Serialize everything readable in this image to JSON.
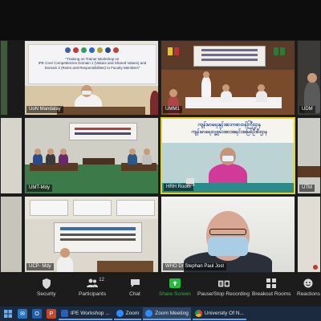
{
  "tiles": {
    "uon_mandalay": {
      "label": "UoN Mandalay",
      "banner_line1": "\"Training on Trainer Workshop on",
      "banner_line2": "IPE Core Competencies Domain 1 (Values and Shared Values) and",
      "banner_line3": "Domain 2 (Roles and Responsibilities) to Faculty Members\""
    },
    "umm1": {
      "label": "UMM1"
    },
    "udm": {
      "label": "UDM"
    },
    "umt_mdy": {
      "label": "UMT-Mdy"
    },
    "hrh_room": {
      "label": "HRH Room",
      "banner_line1": "ကျန်းမာရေးနှင့်အားကစားဝန်ကြီးဌာန",
      "banner_line2": "ကျန်းမာရေးလူ့စွမ်းအားအရင်းအမြစ်ဦးစီးဌာန"
    },
    "utm": {
      "label": "UTM"
    },
    "ucp_mdy": {
      "label": "UCP- Mdy"
    },
    "who": {
      "label": "WHO Dr Stephan Paul Jost"
    }
  },
  "toolbar": {
    "security": "Security",
    "participants": "Participants",
    "participants_count": "12",
    "chat": "Chat",
    "share_screen": "Share Screen",
    "recording": "Pause/Stop Recording",
    "breakout": "Breakout Rooms",
    "reactions": "Reactions"
  },
  "taskbar": {
    "ipe_workshop": "IPE Workshop ...",
    "zoom": "Zoom",
    "zoom_meeting": "Zoom Meeting",
    "chrome_tab": "University Of N..."
  },
  "colors": {
    "active_border": "#e6d31b",
    "share_green": "#1fbf3a",
    "taskbar_bg": "#1b2a3f"
  }
}
